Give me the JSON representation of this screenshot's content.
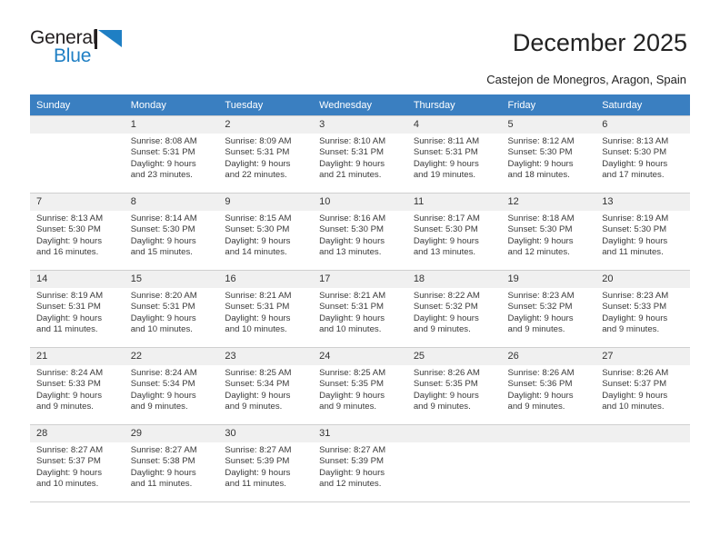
{
  "brand": {
    "name_top": "General",
    "name_bottom": "Blue",
    "accent_color": "#1f7fc4",
    "dark_color": "#231f20"
  },
  "header": {
    "title": "December 2025",
    "subtitle": "Castejon de Monegros, Aragon, Spain"
  },
  "calendar": {
    "header_bg": "#3a7fc1",
    "daynum_bg": "#f0f0f0",
    "weekday_headers": [
      "Sunday",
      "Monday",
      "Tuesday",
      "Wednesday",
      "Thursday",
      "Friday",
      "Saturday"
    ],
    "weeks": [
      [
        {
          "day": "",
          "sunrise": "",
          "sunset": "",
          "daylight_line1": "",
          "daylight_line2": ""
        },
        {
          "day": "1",
          "sunrise": "Sunrise: 8:08 AM",
          "sunset": "Sunset: 5:31 PM",
          "daylight_line1": "Daylight: 9 hours",
          "daylight_line2": "and 23 minutes."
        },
        {
          "day": "2",
          "sunrise": "Sunrise: 8:09 AM",
          "sunset": "Sunset: 5:31 PM",
          "daylight_line1": "Daylight: 9 hours",
          "daylight_line2": "and 22 minutes."
        },
        {
          "day": "3",
          "sunrise": "Sunrise: 8:10 AM",
          "sunset": "Sunset: 5:31 PM",
          "daylight_line1": "Daylight: 9 hours",
          "daylight_line2": "and 21 minutes."
        },
        {
          "day": "4",
          "sunrise": "Sunrise: 8:11 AM",
          "sunset": "Sunset: 5:31 PM",
          "daylight_line1": "Daylight: 9 hours",
          "daylight_line2": "and 19 minutes."
        },
        {
          "day": "5",
          "sunrise": "Sunrise: 8:12 AM",
          "sunset": "Sunset: 5:30 PM",
          "daylight_line1": "Daylight: 9 hours",
          "daylight_line2": "and 18 minutes."
        },
        {
          "day": "6",
          "sunrise": "Sunrise: 8:13 AM",
          "sunset": "Sunset: 5:30 PM",
          "daylight_line1": "Daylight: 9 hours",
          "daylight_line2": "and 17 minutes."
        }
      ],
      [
        {
          "day": "7",
          "sunrise": "Sunrise: 8:13 AM",
          "sunset": "Sunset: 5:30 PM",
          "daylight_line1": "Daylight: 9 hours",
          "daylight_line2": "and 16 minutes."
        },
        {
          "day": "8",
          "sunrise": "Sunrise: 8:14 AM",
          "sunset": "Sunset: 5:30 PM",
          "daylight_line1": "Daylight: 9 hours",
          "daylight_line2": "and 15 minutes."
        },
        {
          "day": "9",
          "sunrise": "Sunrise: 8:15 AM",
          "sunset": "Sunset: 5:30 PM",
          "daylight_line1": "Daylight: 9 hours",
          "daylight_line2": "and 14 minutes."
        },
        {
          "day": "10",
          "sunrise": "Sunrise: 8:16 AM",
          "sunset": "Sunset: 5:30 PM",
          "daylight_line1": "Daylight: 9 hours",
          "daylight_line2": "and 13 minutes."
        },
        {
          "day": "11",
          "sunrise": "Sunrise: 8:17 AM",
          "sunset": "Sunset: 5:30 PM",
          "daylight_line1": "Daylight: 9 hours",
          "daylight_line2": "and 13 minutes."
        },
        {
          "day": "12",
          "sunrise": "Sunrise: 8:18 AM",
          "sunset": "Sunset: 5:30 PM",
          "daylight_line1": "Daylight: 9 hours",
          "daylight_line2": "and 12 minutes."
        },
        {
          "day": "13",
          "sunrise": "Sunrise: 8:19 AM",
          "sunset": "Sunset: 5:30 PM",
          "daylight_line1": "Daylight: 9 hours",
          "daylight_line2": "and 11 minutes."
        }
      ],
      [
        {
          "day": "14",
          "sunrise": "Sunrise: 8:19 AM",
          "sunset": "Sunset: 5:31 PM",
          "daylight_line1": "Daylight: 9 hours",
          "daylight_line2": "and 11 minutes."
        },
        {
          "day": "15",
          "sunrise": "Sunrise: 8:20 AM",
          "sunset": "Sunset: 5:31 PM",
          "daylight_line1": "Daylight: 9 hours",
          "daylight_line2": "and 10 minutes."
        },
        {
          "day": "16",
          "sunrise": "Sunrise: 8:21 AM",
          "sunset": "Sunset: 5:31 PM",
          "daylight_line1": "Daylight: 9 hours",
          "daylight_line2": "and 10 minutes."
        },
        {
          "day": "17",
          "sunrise": "Sunrise: 8:21 AM",
          "sunset": "Sunset: 5:31 PM",
          "daylight_line1": "Daylight: 9 hours",
          "daylight_line2": "and 10 minutes."
        },
        {
          "day": "18",
          "sunrise": "Sunrise: 8:22 AM",
          "sunset": "Sunset: 5:32 PM",
          "daylight_line1": "Daylight: 9 hours",
          "daylight_line2": "and 9 minutes."
        },
        {
          "day": "19",
          "sunrise": "Sunrise: 8:23 AM",
          "sunset": "Sunset: 5:32 PM",
          "daylight_line1": "Daylight: 9 hours",
          "daylight_line2": "and 9 minutes."
        },
        {
          "day": "20",
          "sunrise": "Sunrise: 8:23 AM",
          "sunset": "Sunset: 5:33 PM",
          "daylight_line1": "Daylight: 9 hours",
          "daylight_line2": "and 9 minutes."
        }
      ],
      [
        {
          "day": "21",
          "sunrise": "Sunrise: 8:24 AM",
          "sunset": "Sunset: 5:33 PM",
          "daylight_line1": "Daylight: 9 hours",
          "daylight_line2": "and 9 minutes."
        },
        {
          "day": "22",
          "sunrise": "Sunrise: 8:24 AM",
          "sunset": "Sunset: 5:34 PM",
          "daylight_line1": "Daylight: 9 hours",
          "daylight_line2": "and 9 minutes."
        },
        {
          "day": "23",
          "sunrise": "Sunrise: 8:25 AM",
          "sunset": "Sunset: 5:34 PM",
          "daylight_line1": "Daylight: 9 hours",
          "daylight_line2": "and 9 minutes."
        },
        {
          "day": "24",
          "sunrise": "Sunrise: 8:25 AM",
          "sunset": "Sunset: 5:35 PM",
          "daylight_line1": "Daylight: 9 hours",
          "daylight_line2": "and 9 minutes."
        },
        {
          "day": "25",
          "sunrise": "Sunrise: 8:26 AM",
          "sunset": "Sunset: 5:35 PM",
          "daylight_line1": "Daylight: 9 hours",
          "daylight_line2": "and 9 minutes."
        },
        {
          "day": "26",
          "sunrise": "Sunrise: 8:26 AM",
          "sunset": "Sunset: 5:36 PM",
          "daylight_line1": "Daylight: 9 hours",
          "daylight_line2": "and 9 minutes."
        },
        {
          "day": "27",
          "sunrise": "Sunrise: 8:26 AM",
          "sunset": "Sunset: 5:37 PM",
          "daylight_line1": "Daylight: 9 hours",
          "daylight_line2": "and 10 minutes."
        }
      ],
      [
        {
          "day": "28",
          "sunrise": "Sunrise: 8:27 AM",
          "sunset": "Sunset: 5:37 PM",
          "daylight_line1": "Daylight: 9 hours",
          "daylight_line2": "and 10 minutes."
        },
        {
          "day": "29",
          "sunrise": "Sunrise: 8:27 AM",
          "sunset": "Sunset: 5:38 PM",
          "daylight_line1": "Daylight: 9 hours",
          "daylight_line2": "and 11 minutes."
        },
        {
          "day": "30",
          "sunrise": "Sunrise: 8:27 AM",
          "sunset": "Sunset: 5:39 PM",
          "daylight_line1": "Daylight: 9 hours",
          "daylight_line2": "and 11 minutes."
        },
        {
          "day": "31",
          "sunrise": "Sunrise: 8:27 AM",
          "sunset": "Sunset: 5:39 PM",
          "daylight_line1": "Daylight: 9 hours",
          "daylight_line2": "and 12 minutes."
        },
        {
          "day": "",
          "sunrise": "",
          "sunset": "",
          "daylight_line1": "",
          "daylight_line2": ""
        },
        {
          "day": "",
          "sunrise": "",
          "sunset": "",
          "daylight_line1": "",
          "daylight_line2": ""
        },
        {
          "day": "",
          "sunrise": "",
          "sunset": "",
          "daylight_line1": "",
          "daylight_line2": ""
        }
      ]
    ]
  }
}
